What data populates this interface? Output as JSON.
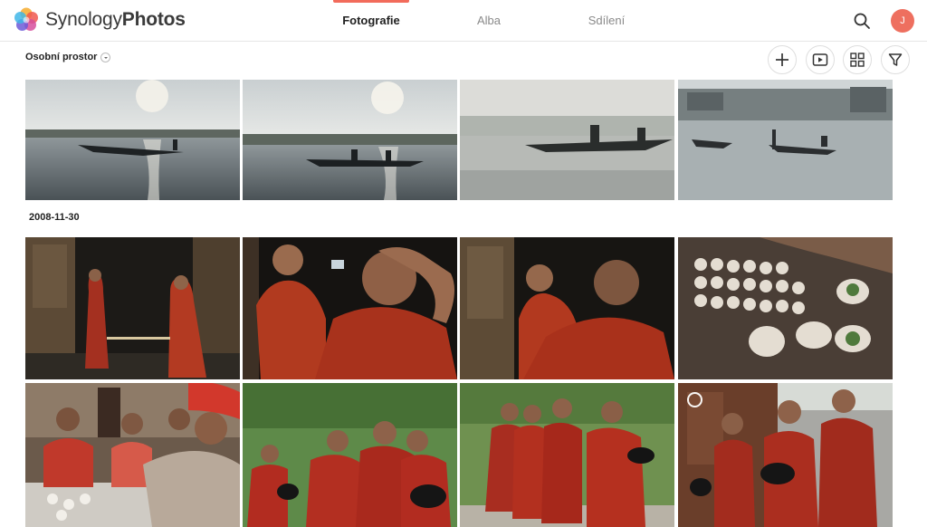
{
  "app": {
    "brand_part1": "Synology",
    "brand_part2": "Photos",
    "logo_icon": "synology-photos-flower-icon",
    "accent_color": "#f26b5b"
  },
  "nav": {
    "tabs": [
      {
        "label": "Fotografie",
        "active": true
      },
      {
        "label": "Alba",
        "active": false
      },
      {
        "label": "Sdílení",
        "active": false
      }
    ]
  },
  "user": {
    "initial": "J",
    "avatar_color": "#ee6f5f"
  },
  "toolbar": {
    "space_label": "Osobní prostor",
    "buttons": [
      "plus-icon",
      "slideshow-icon",
      "grid-view-icon",
      "filter-icon"
    ]
  },
  "groups": [
    {
      "date": "",
      "photos": [
        {
          "subject": "misty lake, single rower at sunrise"
        },
        {
          "subject": "misty lake, two rowers in canoe"
        },
        {
          "subject": "fog over reeds, boat with two people"
        },
        {
          "subject": "stilt village, fishermen boats"
        }
      ]
    },
    {
      "date": "2008-11-30",
      "photos": [
        {
          "subject": "two monks in dark doorway"
        },
        {
          "subject": "smiling monk, monk rubbing head"
        },
        {
          "subject": "monk smiling, shaved head from behind"
        },
        {
          "subject": "dumplings being folded on table"
        },
        {
          "subject": "women cooking at table"
        },
        {
          "subject": "novice monks with alms bowls on grass"
        },
        {
          "subject": "novice monks walking in line"
        },
        {
          "subject": "novice monks holding bowls near wooden house"
        }
      ]
    }
  ]
}
